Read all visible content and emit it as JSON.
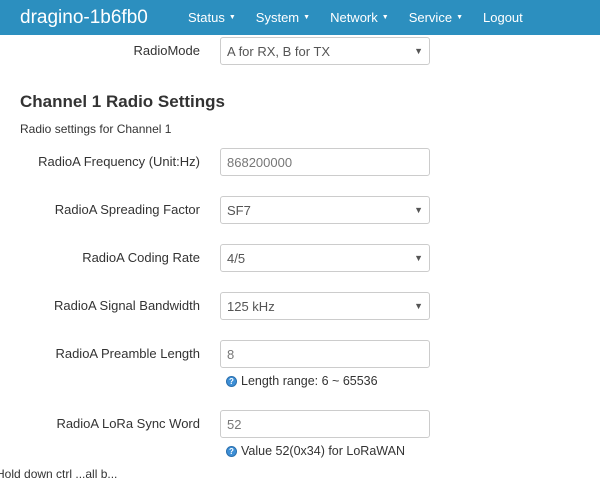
{
  "brand": "dragino-1b6fb0",
  "nav": [
    {
      "label": "Status",
      "dropdown": true
    },
    {
      "label": "System",
      "dropdown": true
    },
    {
      "label": "Network",
      "dropdown": true
    },
    {
      "label": "Service",
      "dropdown": true
    },
    {
      "label": "Logout",
      "dropdown": false
    }
  ],
  "radio_mode": {
    "label": "RadioMode",
    "value": "A for RX, B for TX"
  },
  "section": {
    "title": "Channel 1 Radio Settings",
    "description": "Radio settings for Channel 1"
  },
  "fields": {
    "frequency": {
      "label": "RadioA Frequency (Unit:Hz)",
      "value": "868200000"
    },
    "spreading_factor": {
      "label": "RadioA Spreading Factor",
      "value": "SF7"
    },
    "coding_rate": {
      "label": "RadioA Coding Rate",
      "value": "4/5"
    },
    "bandwidth": {
      "label": "RadioA Signal Bandwidth",
      "value": "125 kHz"
    },
    "preamble": {
      "label": "RadioA Preamble Length",
      "value": "8",
      "hint": "Length range: 6 ~ 65536"
    },
    "sync_word": {
      "label": "RadioA LoRa Sync Word",
      "value": "52",
      "hint": "Value 52(0x34) for LoRaWAN"
    }
  },
  "bottom_partial_text": "Hold down  ctrl  ...all b..."
}
